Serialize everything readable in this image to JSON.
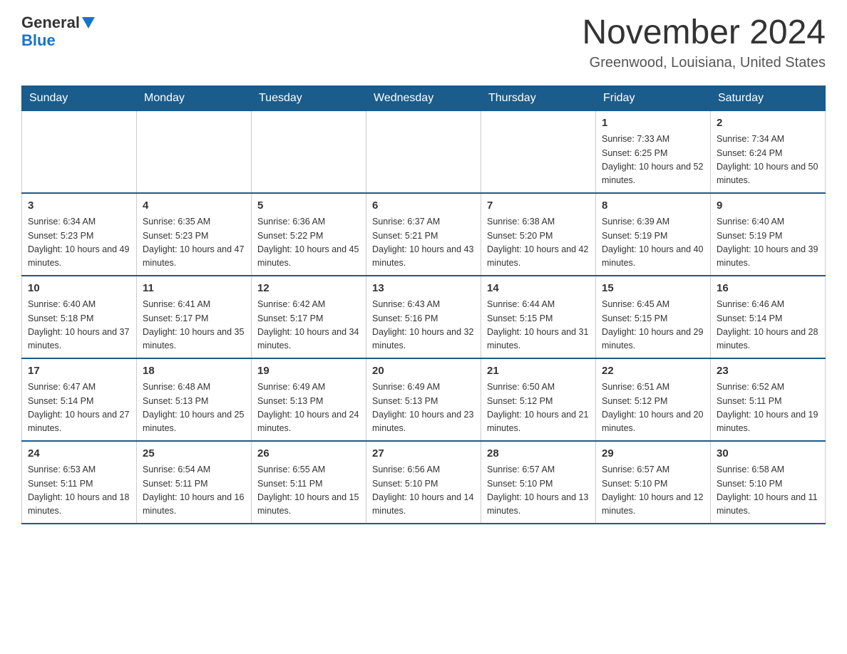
{
  "logo": {
    "general": "General",
    "blue": "Blue"
  },
  "title": "November 2024",
  "location": "Greenwood, Louisiana, United States",
  "days_of_week": [
    "Sunday",
    "Monday",
    "Tuesday",
    "Wednesday",
    "Thursday",
    "Friday",
    "Saturday"
  ],
  "weeks": [
    [
      {
        "day": "",
        "info": ""
      },
      {
        "day": "",
        "info": ""
      },
      {
        "day": "",
        "info": ""
      },
      {
        "day": "",
        "info": ""
      },
      {
        "day": "",
        "info": ""
      },
      {
        "day": "1",
        "info": "Sunrise: 7:33 AM\nSunset: 6:25 PM\nDaylight: 10 hours and 52 minutes."
      },
      {
        "day": "2",
        "info": "Sunrise: 7:34 AM\nSunset: 6:24 PM\nDaylight: 10 hours and 50 minutes."
      }
    ],
    [
      {
        "day": "3",
        "info": "Sunrise: 6:34 AM\nSunset: 5:23 PM\nDaylight: 10 hours and 49 minutes."
      },
      {
        "day": "4",
        "info": "Sunrise: 6:35 AM\nSunset: 5:23 PM\nDaylight: 10 hours and 47 minutes."
      },
      {
        "day": "5",
        "info": "Sunrise: 6:36 AM\nSunset: 5:22 PM\nDaylight: 10 hours and 45 minutes."
      },
      {
        "day": "6",
        "info": "Sunrise: 6:37 AM\nSunset: 5:21 PM\nDaylight: 10 hours and 43 minutes."
      },
      {
        "day": "7",
        "info": "Sunrise: 6:38 AM\nSunset: 5:20 PM\nDaylight: 10 hours and 42 minutes."
      },
      {
        "day": "8",
        "info": "Sunrise: 6:39 AM\nSunset: 5:19 PM\nDaylight: 10 hours and 40 minutes."
      },
      {
        "day": "9",
        "info": "Sunrise: 6:40 AM\nSunset: 5:19 PM\nDaylight: 10 hours and 39 minutes."
      }
    ],
    [
      {
        "day": "10",
        "info": "Sunrise: 6:40 AM\nSunset: 5:18 PM\nDaylight: 10 hours and 37 minutes."
      },
      {
        "day": "11",
        "info": "Sunrise: 6:41 AM\nSunset: 5:17 PM\nDaylight: 10 hours and 35 minutes."
      },
      {
        "day": "12",
        "info": "Sunrise: 6:42 AM\nSunset: 5:17 PM\nDaylight: 10 hours and 34 minutes."
      },
      {
        "day": "13",
        "info": "Sunrise: 6:43 AM\nSunset: 5:16 PM\nDaylight: 10 hours and 32 minutes."
      },
      {
        "day": "14",
        "info": "Sunrise: 6:44 AM\nSunset: 5:15 PM\nDaylight: 10 hours and 31 minutes."
      },
      {
        "day": "15",
        "info": "Sunrise: 6:45 AM\nSunset: 5:15 PM\nDaylight: 10 hours and 29 minutes."
      },
      {
        "day": "16",
        "info": "Sunrise: 6:46 AM\nSunset: 5:14 PM\nDaylight: 10 hours and 28 minutes."
      }
    ],
    [
      {
        "day": "17",
        "info": "Sunrise: 6:47 AM\nSunset: 5:14 PM\nDaylight: 10 hours and 27 minutes."
      },
      {
        "day": "18",
        "info": "Sunrise: 6:48 AM\nSunset: 5:13 PM\nDaylight: 10 hours and 25 minutes."
      },
      {
        "day": "19",
        "info": "Sunrise: 6:49 AM\nSunset: 5:13 PM\nDaylight: 10 hours and 24 minutes."
      },
      {
        "day": "20",
        "info": "Sunrise: 6:49 AM\nSunset: 5:13 PM\nDaylight: 10 hours and 23 minutes."
      },
      {
        "day": "21",
        "info": "Sunrise: 6:50 AM\nSunset: 5:12 PM\nDaylight: 10 hours and 21 minutes."
      },
      {
        "day": "22",
        "info": "Sunrise: 6:51 AM\nSunset: 5:12 PM\nDaylight: 10 hours and 20 minutes."
      },
      {
        "day": "23",
        "info": "Sunrise: 6:52 AM\nSunset: 5:11 PM\nDaylight: 10 hours and 19 minutes."
      }
    ],
    [
      {
        "day": "24",
        "info": "Sunrise: 6:53 AM\nSunset: 5:11 PM\nDaylight: 10 hours and 18 minutes."
      },
      {
        "day": "25",
        "info": "Sunrise: 6:54 AM\nSunset: 5:11 PM\nDaylight: 10 hours and 16 minutes."
      },
      {
        "day": "26",
        "info": "Sunrise: 6:55 AM\nSunset: 5:11 PM\nDaylight: 10 hours and 15 minutes."
      },
      {
        "day": "27",
        "info": "Sunrise: 6:56 AM\nSunset: 5:10 PM\nDaylight: 10 hours and 14 minutes."
      },
      {
        "day": "28",
        "info": "Sunrise: 6:57 AM\nSunset: 5:10 PM\nDaylight: 10 hours and 13 minutes."
      },
      {
        "day": "29",
        "info": "Sunrise: 6:57 AM\nSunset: 5:10 PM\nDaylight: 10 hours and 12 minutes."
      },
      {
        "day": "30",
        "info": "Sunrise: 6:58 AM\nSunset: 5:10 PM\nDaylight: 10 hours and 11 minutes."
      }
    ]
  ]
}
